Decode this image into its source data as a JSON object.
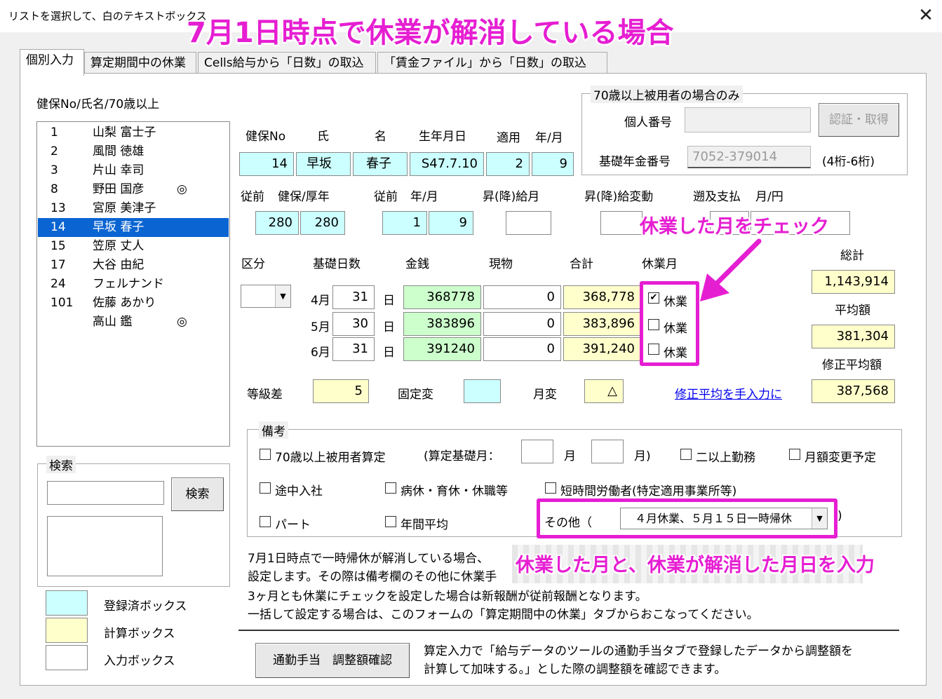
{
  "window": {
    "title": "リストを選択して、白のテキストボックス",
    "close": "✕"
  },
  "headline": "7月1日時点で休業が解消している場合",
  "tabs": [
    "個別入力",
    "算定期間中の休業",
    "Cells給与から「日数」の取込",
    "「賃金ファイル」から「日数」の取込"
  ],
  "list": {
    "header": "健保No/氏名/70歳以上",
    "items": [
      {
        "no": "1",
        "name": "山梨 富士子",
        "mark": ""
      },
      {
        "no": "2",
        "name": "風間 徳雄",
        "mark": ""
      },
      {
        "no": "3",
        "name": "片山 幸司",
        "mark": ""
      },
      {
        "no": "8",
        "name": "野田 国彦",
        "mark": "◎"
      },
      {
        "no": "13",
        "name": "宮原 美津子",
        "mark": ""
      },
      {
        "no": "14",
        "name": "早坂 春子",
        "mark": ""
      },
      {
        "no": "15",
        "name": "笠原 丈人",
        "mark": ""
      },
      {
        "no": "17",
        "name": "大谷 由紀",
        "mark": ""
      },
      {
        "no": "24",
        "name": "フェルナンド",
        "mark": ""
      },
      {
        "no": "101",
        "name": "佐藤 あかり",
        "mark": ""
      },
      {
        "no": "",
        "name": "高山 鑑",
        "mark": "◎"
      }
    ],
    "selected_index": 5
  },
  "search": {
    "title": "検索",
    "button": "検索",
    "value": ""
  },
  "legend": {
    "registered": "登録済ボックス",
    "calc": "計算ボックス",
    "input": "入力ボックス"
  },
  "person": {
    "headers": {
      "no": "健保No",
      "sei": "氏",
      "mei": "名",
      "birth": "生年月日",
      "apply": "適用",
      "ym": "年/月"
    },
    "no": "14",
    "sei": "早坂",
    "mei": "春子",
    "birth": "S47.7.10",
    "apply_year": "2",
    "apply_month": "9"
  },
  "prev": {
    "label1": "従前",
    "label2": "健保/厚年",
    "label3": "従前",
    "label4": "年/月",
    "kenpo": "280",
    "kounen": "280",
    "year": "1",
    "month": "9"
  },
  "raise": {
    "month_label": "昇(降)給月",
    "change_label": "昇(降)給変動",
    "retro_label": "遡及支払",
    "retro_unit": "月/円",
    "month": "",
    "change": ""
  },
  "over70": {
    "title": "70歳以上被用者の場合のみ",
    "personal_label": "個人番号",
    "personal_value": "",
    "auth_button": "認証・取得",
    "pension_label": "基礎年金番号",
    "pension_value": "7052-379014",
    "pension_hint": "(4桁-6桁)"
  },
  "months": {
    "headers": {
      "kubun": "区分",
      "days": "基礎日数",
      "cash": "金銭",
      "goods": "現物",
      "total": "合計",
      "leave": "休業月"
    },
    "kubun_value": "",
    "day_unit": "日",
    "leave_label": "休業",
    "rows": [
      {
        "month": "4月",
        "days": "31",
        "cash": "368778",
        "goods": "0",
        "total": "368,778",
        "leave": true
      },
      {
        "month": "5月",
        "days": "30",
        "cash": "383896",
        "goods": "0",
        "total": "383,896",
        "leave": false
      },
      {
        "month": "6月",
        "days": "31",
        "cash": "391240",
        "goods": "0",
        "total": "391,240",
        "leave": false
      }
    ]
  },
  "summary": {
    "total_label": "総計",
    "total": "1,143,914",
    "avg_label": "平均額",
    "avg": "381,304",
    "adj_label": "修正平均額",
    "adj": "387,568",
    "adj_link": "修正平均を手入力に"
  },
  "grade": {
    "diff_label": "等級差",
    "diff": "5",
    "fixed_label": "固定変",
    "fixed": "",
    "monthly_label": "月変",
    "monthly": "△"
  },
  "notes": {
    "title": "備考",
    "over70": "70歳以上被用者算定",
    "base_month_label": "(算定基礎月：",
    "month_unit": "月",
    "month_close": "月)",
    "multi": "二以上勤務",
    "change_plan": "月額変更予定",
    "midjoin": "途中入社",
    "sick": "病休・育休・休職等",
    "short": "短時間労働者(特定適用事業所等)",
    "part": "パート",
    "annual": "年間平均",
    "other_label": "その他（",
    "other_value": "４月休業、５月１５日一時帰休",
    "other_close": ")"
  },
  "info": [
    "7月1日時点で一時帰休が解消している場合、",
    "設定します。その際は備考欄のその他に休業手",
    "3ヶ月とも休業にチェックを設定した場合は新報酬が従前報酬となります。",
    "一括して設定する場合は、このフォームの「算定期間中の休業」タブからおこなってください。"
  ],
  "commute": {
    "button": "通勤手当　調整額確認",
    "desc1": "算定入力で「給与データのツールの通勤手当タブで登録したデータから調整額を",
    "desc2": "計算して加味する。」とした際の調整額を確認できます。"
  },
  "annotations": {
    "check_leave": "休業した月をチェック",
    "enter_month": "休業した月と、休業が解消した月日を入力"
  },
  "colors": {
    "magenta": "#e61ed2",
    "cyan": "#ccffff",
    "yellow": "#ffffcc",
    "green": "#ccffcc",
    "selected": "#0a64d2"
  }
}
